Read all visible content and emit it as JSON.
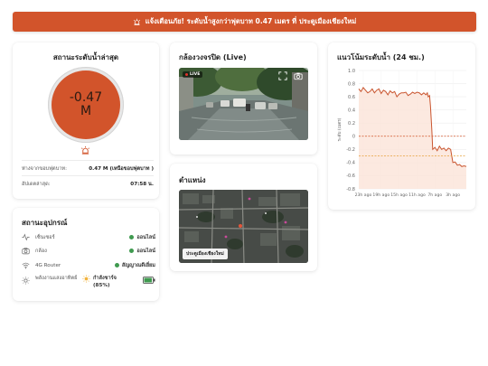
{
  "alert": {
    "icon": "siren-icon",
    "text": "แจ้งเตือนภัย! ระดับน้ำสูงกว่าฟุตบาท 0.47 เมตร ที่ ประตูเมืองเชียงใหม่"
  },
  "water": {
    "title": "สถานะระดับน้ำล่าสุด",
    "value": "-0.47",
    "unit": "M",
    "warning_icon": "siren-icon",
    "distance_label": "ห่างจากขอบฟุตบาท:",
    "distance_value": "0.47 M (เหนือขอบฟุตบาท )",
    "updated_label": "อัปเดตล่าสุด:",
    "updated_value": "07:58 น."
  },
  "equipment": {
    "title": "สถานะอุปกรณ์",
    "items": [
      {
        "icon": "pulse-icon",
        "name": "เซ็นเซอร์",
        "status": "ออนไลน์"
      },
      {
        "icon": "camera-icon",
        "name": "กล้อง",
        "status": "ออนไลน์"
      },
      {
        "icon": "wifi-icon",
        "name": "4G Router",
        "status": "สัญญาณดีเยี่ยม"
      },
      {
        "icon": "sun-icon",
        "name": "พลังงานแสงอาทิตย์",
        "status": "กำลังชาร์จ (85%)",
        "battery_level": 0.85
      }
    ]
  },
  "cctv": {
    "title": "กล้องวงจรปิด (Live)",
    "live_label": "LIVE"
  },
  "location": {
    "title": "ตำแหน่ง",
    "label": "ประตูเมืองเชียงใหม่"
  },
  "trend": {
    "title": "แนวโน้มระดับน้ำ (24 ชม.)"
  },
  "colors": {
    "accent": "#d2542b",
    "online": "#3f9a4f"
  },
  "chart_data": {
    "type": "area",
    "ylabel": "ระดับ (เมตร)",
    "ylim": [
      -0.8,
      1.0
    ],
    "yticks": [
      1.0,
      0.8,
      0.6,
      0.4,
      0.2,
      0,
      -0.2,
      -0.4,
      -0.6,
      -0.8
    ],
    "xtick_labels": [
      "23h ago",
      "19h ago",
      "15h ago",
      "11h ago",
      "7h ago",
      "3h ago"
    ],
    "xtick_hours_ago": [
      23,
      19,
      15,
      11,
      7,
      3
    ],
    "reference_lines": [
      {
        "value": 0,
        "style": "dashed",
        "color": "#d2542b"
      },
      {
        "value": -0.3,
        "style": "dashed",
        "color": "#e6a13c"
      }
    ],
    "series": [
      {
        "hours_ago": [
          24,
          23.5,
          23,
          22.5,
          22,
          21.5,
          21,
          20.5,
          20,
          19.5,
          19,
          18.5,
          18,
          17.5,
          17,
          16.5,
          16,
          15.5,
          15,
          14.5,
          14,
          13.5,
          13,
          12.5,
          12,
          11.5,
          11,
          10.5,
          10,
          9.5,
          9,
          8.7,
          8.5,
          8.2,
          8,
          7.7,
          7.5,
          7,
          6.5,
          6,
          5.5,
          5,
          4.5,
          4,
          3.5,
          3,
          2.5,
          2,
          1.5,
          1,
          0.5,
          0
        ],
        "values": [
          0.72,
          0.68,
          0.74,
          0.7,
          0.66,
          0.68,
          0.72,
          0.66,
          0.7,
          0.72,
          0.65,
          0.7,
          0.68,
          0.63,
          0.69,
          0.66,
          0.68,
          0.6,
          0.64,
          0.66,
          0.66,
          0.67,
          0.62,
          0.64,
          0.67,
          0.65,
          0.67,
          0.66,
          0.63,
          0.66,
          0.63,
          0.66,
          0.6,
          0.62,
          0.46,
          0.1,
          -0.2,
          -0.17,
          -0.22,
          -0.15,
          -0.2,
          -0.18,
          -0.22,
          -0.18,
          -0.2,
          -0.4,
          -0.39,
          -0.44,
          -0.43,
          -0.46,
          -0.45,
          -0.46
        ]
      }
    ],
    "grid": true
  }
}
